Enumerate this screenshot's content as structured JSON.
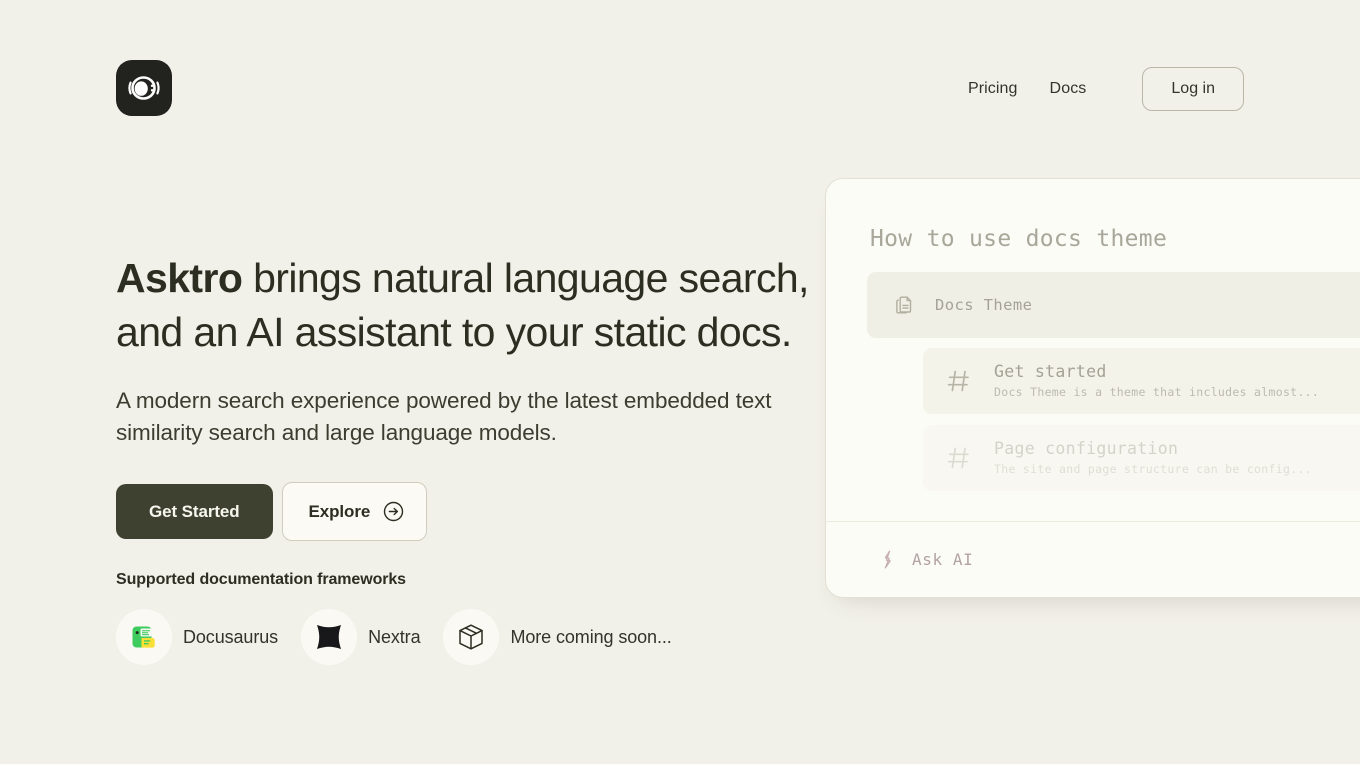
{
  "brand": {
    "logo_icon": "asktro-eye-logo-icon",
    "name": "Asktro"
  },
  "colors": {
    "page_background": "#f2f1e9",
    "panel_background": "#fcfcf7",
    "primary_button": "#3f4130",
    "text": "#2d2e22",
    "muted_mono_text": "#a8a79a",
    "ask_ai_accent": "#b3a2a4",
    "docusaurus_green": "#3ecc5f",
    "docusaurus_yellow": "#fae036"
  },
  "header": {
    "nav_links": [
      {
        "label": "Pricing",
        "name": "nav-link-pricing"
      },
      {
        "label": "Docs",
        "name": "nav-link-docs"
      }
    ],
    "login_label": "Log in"
  },
  "hero": {
    "headline_line1_bold": "Asktro",
    "headline_line1_rest": " brings natural language search,",
    "headline_line2": "and an AI assistant to your static docs.",
    "subhead_line1": "A modern search experience powered by the latest embedded",
    "subhead_line2": "text similarity search and large language models.",
    "primary_cta": "Get Started",
    "secondary_cta": "Explore",
    "secondary_cta_icon": "arrow-right-circle-icon"
  },
  "frameworks": {
    "title": "Supported documentation frameworks",
    "items": [
      {
        "label": "Docusaurus",
        "icon": "docusaurus-logo-icon"
      },
      {
        "label": "Nextra",
        "icon": "nextra-logo-icon"
      },
      {
        "label": "More coming soon...",
        "icon": "package-box-icon"
      }
    ]
  },
  "search_panel": {
    "query": "How to use docs theme",
    "top_result": {
      "icon": "documents-stack-icon",
      "label": "Docs Theme"
    },
    "sub_results": [
      {
        "icon": "hash-icon",
        "title": "Get started",
        "description": "Docs Theme is a theme that includes almost..."
      },
      {
        "icon": "hash-icon",
        "title": "Page configuration",
        "description": "The site and page structure can be config..."
      }
    ],
    "footer": {
      "icon": "lightning-sparkle-icon",
      "label": "Ask AI"
    }
  }
}
